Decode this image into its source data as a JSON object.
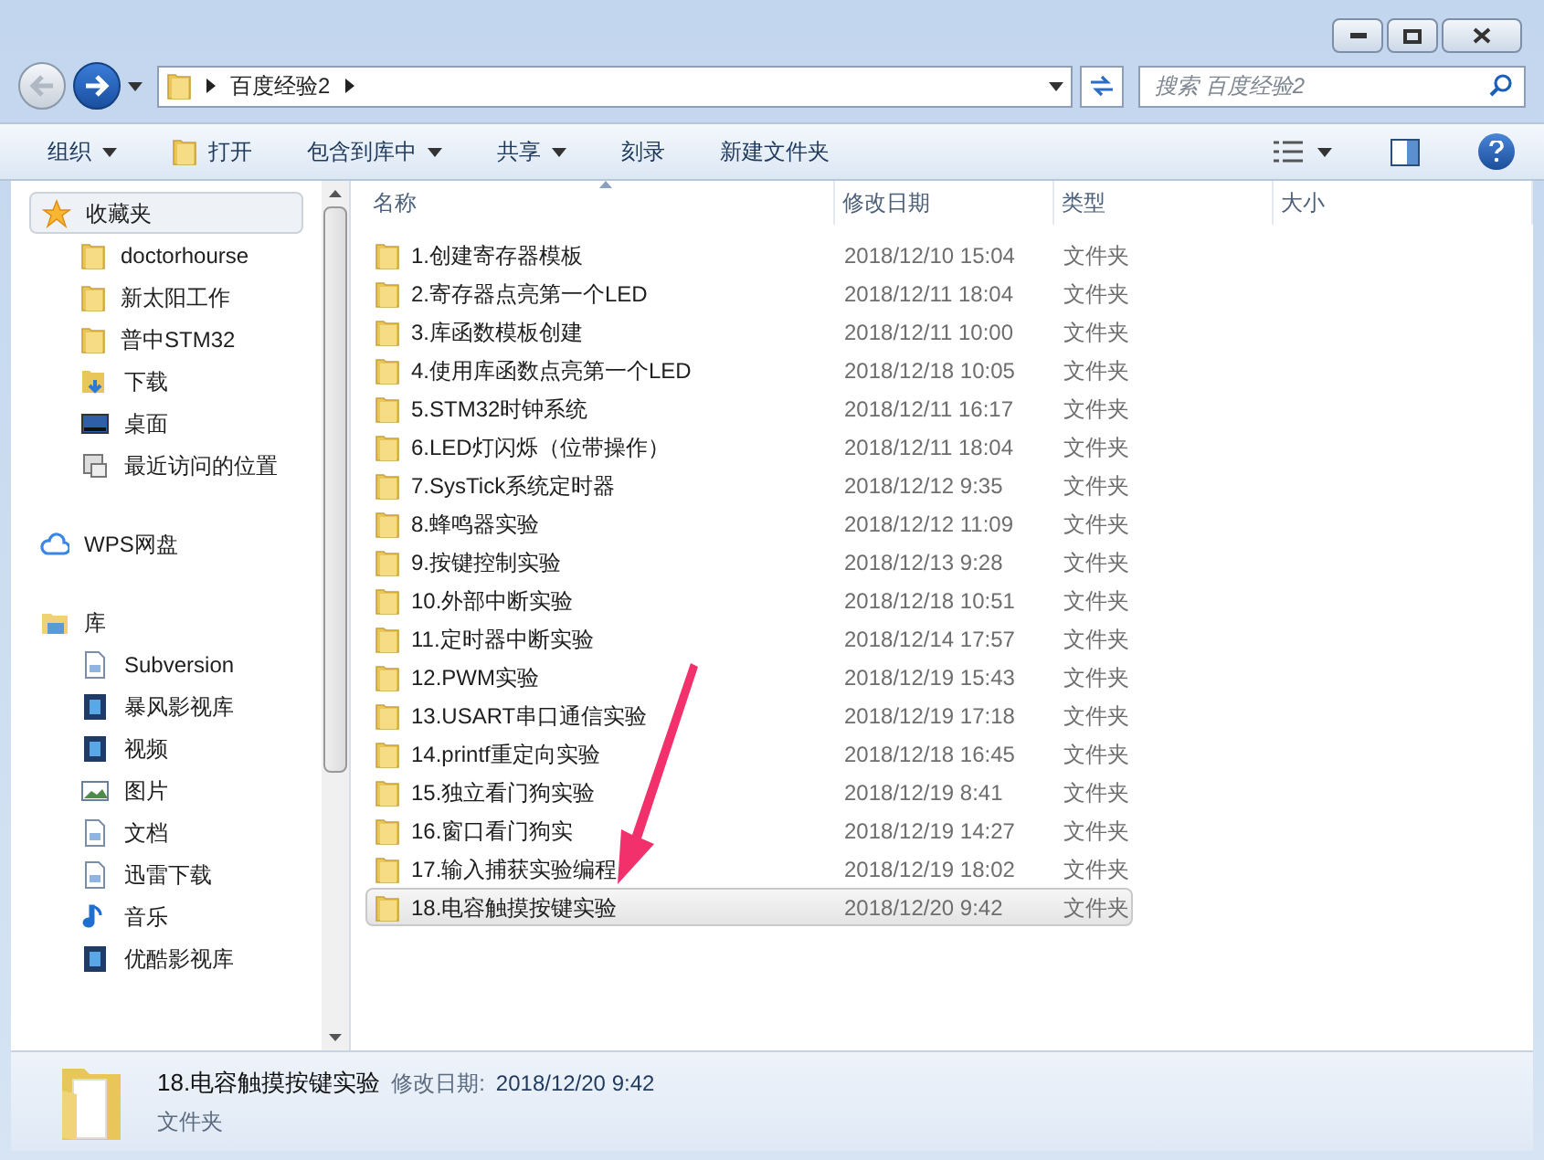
{
  "address": {
    "path": "百度经验2"
  },
  "search": {
    "placeholder": "搜索 百度经验2"
  },
  "toolbar": [
    {
      "label": "组织",
      "kind": "menu"
    },
    {
      "label": "打开",
      "kind": "open"
    },
    {
      "label": "包含到库中",
      "kind": "menu"
    },
    {
      "label": "共享",
      "kind": "menu"
    },
    {
      "label": "刻录",
      "kind": "plain"
    },
    {
      "label": "新建文件夹",
      "kind": "plain"
    }
  ],
  "sidebar": [
    {
      "label": "收藏夹",
      "kind": "star",
      "selected": true,
      "children": [
        {
          "label": "doctorhourse",
          "kind": "folder",
          "selected": false
        },
        {
          "label": "新太阳工作",
          "kind": "folder",
          "selected": false
        },
        {
          "label": "普中STM32",
          "kind": "folder",
          "selected": false
        },
        {
          "label": "下载",
          "kind": "download",
          "selected": false
        },
        {
          "label": "桌面",
          "kind": "desktop",
          "selected": false
        },
        {
          "label": "最近访问的位置",
          "kind": "recent",
          "selected": false
        }
      ]
    },
    {
      "label": "WPS网盘",
      "kind": "cloud",
      "selected": false
    },
    {
      "label": "库",
      "kind": "library",
      "selected": false,
      "children": [
        {
          "label": "Subversion",
          "kind": "document",
          "selected": false
        },
        {
          "label": "暴风影视库",
          "kind": "video",
          "selected": false
        },
        {
          "label": "视频",
          "kind": "video",
          "selected": false
        },
        {
          "label": "图片",
          "kind": "picture",
          "selected": false
        },
        {
          "label": "文档",
          "kind": "document",
          "selected": false
        },
        {
          "label": "迅雷下载",
          "kind": "document",
          "selected": false
        },
        {
          "label": "音乐",
          "kind": "music",
          "selected": false
        },
        {
          "label": "优酷影视库",
          "kind": "video",
          "selected": false
        }
      ]
    }
  ],
  "table": {
    "columns": [
      {
        "label": "名称",
        "sorted": true
      },
      {
        "label": "修改日期",
        "sorted": false
      },
      {
        "label": "类型",
        "sorted": false
      },
      {
        "label": "大小",
        "sorted": false
      }
    ],
    "rows": [
      {
        "name": "1.创建寄存器模板",
        "date": "2018/12/10 15:04",
        "type": "文件夹",
        "selected": false
      },
      {
        "name": "2.寄存器点亮第一个LED",
        "date": "2018/12/11 18:04",
        "type": "文件夹",
        "selected": false
      },
      {
        "name": "3.库函数模板创建",
        "date": "2018/12/11 10:00",
        "type": "文件夹",
        "selected": false
      },
      {
        "name": "4.使用库函数点亮第一个LED",
        "date": "2018/12/18 10:05",
        "type": "文件夹",
        "selected": false
      },
      {
        "name": "5.STM32时钟系统",
        "date": "2018/12/11 16:17",
        "type": "文件夹",
        "selected": false
      },
      {
        "name": "6.LED灯闪烁（位带操作）",
        "date": "2018/12/11 18:04",
        "type": "文件夹",
        "selected": false
      },
      {
        "name": "7.SysTick系统定时器",
        "date": "2018/12/12 9:35",
        "type": "文件夹",
        "selected": false
      },
      {
        "name": "8.蜂鸣器实验",
        "date": "2018/12/12 11:09",
        "type": "文件夹",
        "selected": false
      },
      {
        "name": "9.按键控制实验",
        "date": "2018/12/13 9:28",
        "type": "文件夹",
        "selected": false
      },
      {
        "name": "10.外部中断实验",
        "date": "2018/12/18 10:51",
        "type": "文件夹",
        "selected": false
      },
      {
        "name": "11.定时器中断实验",
        "date": "2018/12/14 17:57",
        "type": "文件夹",
        "selected": false
      },
      {
        "name": "12.PWM实验",
        "date": "2018/12/19 15:43",
        "type": "文件夹",
        "selected": false
      },
      {
        "name": "13.USART串口通信实验",
        "date": "2018/12/19 17:18",
        "type": "文件夹",
        "selected": false
      },
      {
        "name": "14.printf重定向实验",
        "date": "2018/12/18 16:45",
        "type": "文件夹",
        "selected": false
      },
      {
        "name": "15.独立看门狗实验",
        "date": "2018/12/19 8:41",
        "type": "文件夹",
        "selected": false
      },
      {
        "name": "16.窗口看门狗实",
        "date": "2018/12/19 14:27",
        "type": "文件夹",
        "selected": false
      },
      {
        "name": "17.输入捕获实验编程",
        "date": "2018/12/19 18:02",
        "type": "文件夹",
        "selected": false
      },
      {
        "name": "18.电容触摸按键实验",
        "date": "2018/12/20 9:42",
        "type": "文件夹",
        "selected": true
      }
    ]
  },
  "details": {
    "name": "18.电容触摸按键实验",
    "modified_label": "修改日期:",
    "modified": "2018/12/20 9:42",
    "type": "文件夹"
  }
}
